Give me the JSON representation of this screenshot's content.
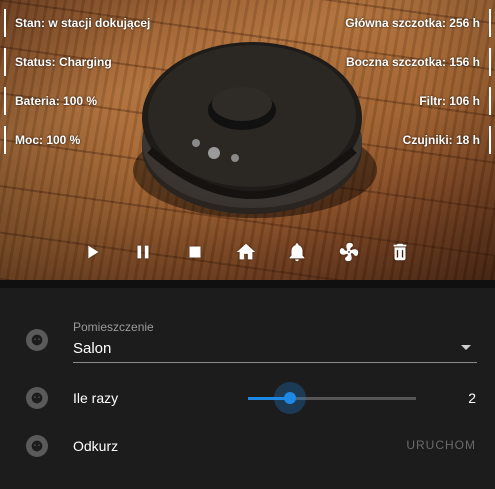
{
  "stats": {
    "stan": "Stan: w stacji dokującej",
    "status": "Status: Charging",
    "bateria": "Bateria: 100 %",
    "moc": "Moc: 100 %",
    "glowna": "Główna szczotka: 256 h",
    "boczna": "Boczna szczotka: 156 h",
    "filtr": "Filtr: 106 h",
    "czujniki": "Czujniki: 18 h"
  },
  "controls": [
    {
      "icon": "play-icon"
    },
    {
      "icon": "pause-icon"
    },
    {
      "icon": "stop-icon"
    },
    {
      "icon": "home-icon"
    },
    {
      "icon": "bell-icon"
    },
    {
      "icon": "fan-icon"
    },
    {
      "icon": "trash-icon"
    }
  ],
  "room": {
    "label": "Pomieszczenie",
    "value": "Salon"
  },
  "repeat": {
    "label": "Ile razy",
    "value": "2",
    "fraction": 0.25
  },
  "vacuum": {
    "label": "Odkurz",
    "button": "URUCHOM"
  },
  "colors": {
    "accent": "#1e88e5",
    "background": "#1c1c1c"
  }
}
